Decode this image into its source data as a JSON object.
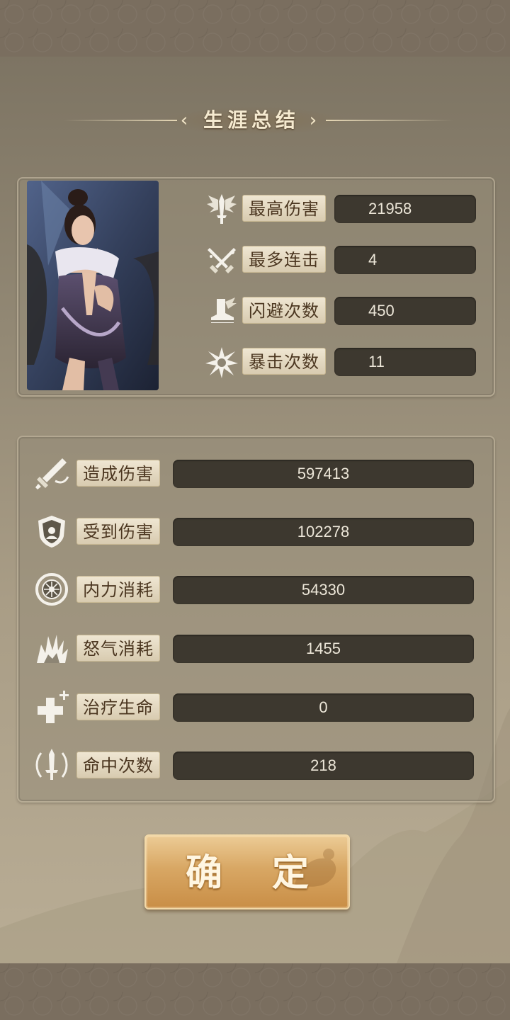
{
  "title": "生涯总结",
  "highlights": [
    {
      "icon": "feathered-sword-icon",
      "label": "最高伤害",
      "value": "21958"
    },
    {
      "icon": "crossed-swords-icon",
      "label": "最多连击",
      "value": "4"
    },
    {
      "icon": "winged-boot-icon",
      "label": "闪避次数",
      "value": "450"
    },
    {
      "icon": "burst-icon",
      "label": "暴击次数",
      "value": "11"
    }
  ],
  "totals": [
    {
      "icon": "slashing-sword-icon",
      "label": "造成伤害",
      "value": "597413"
    },
    {
      "icon": "shield-icon",
      "label": "受到伤害",
      "value": "102278"
    },
    {
      "icon": "energy-orb-icon",
      "label": "内力消耗",
      "value": "54330"
    },
    {
      "icon": "rage-burst-icon",
      "label": "怒气消耗",
      "value": "1455"
    },
    {
      "icon": "healing-cross-icon",
      "label": "治疗生命",
      "value": "0"
    },
    {
      "icon": "targeted-sword-icon",
      "label": "命中次数",
      "value": "218"
    }
  ],
  "confirm_label": "确 定",
  "colors": {
    "panel_bg": "#968c78",
    "value_bg": "#3d382f",
    "label_bg": "#efe6d2",
    "button": "#d8a764"
  }
}
